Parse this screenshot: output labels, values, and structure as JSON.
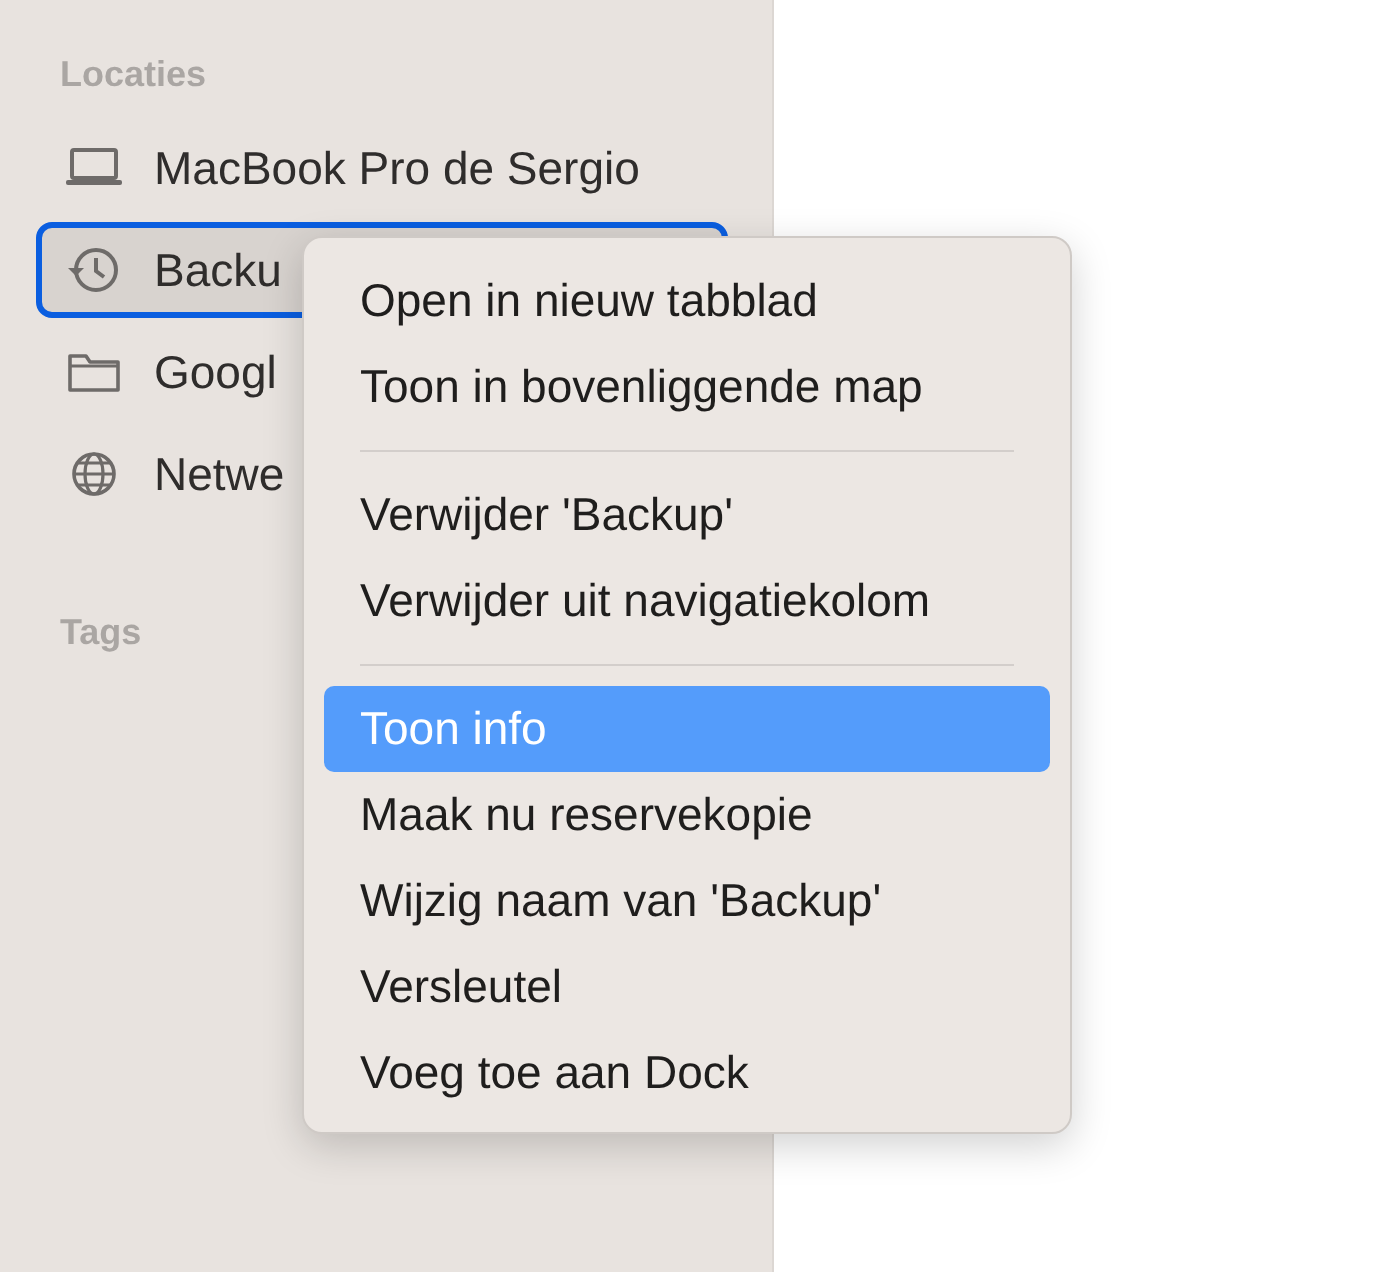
{
  "sidebar": {
    "sections": [
      {
        "title": "Locaties",
        "items": [
          {
            "label": "MacBook Pro de Sergio",
            "kind": "laptop",
            "selected": false
          },
          {
            "label": "Backu",
            "kind": "clock",
            "selected": true
          },
          {
            "label": "Googl",
            "kind": "folder",
            "selected": false
          },
          {
            "label": "Netwe",
            "kind": "globe",
            "selected": false
          }
        ]
      },
      {
        "title": "Tags"
      }
    ]
  },
  "context_menu": {
    "items": [
      {
        "kind": "item",
        "label": "Open in nieuw tabblad",
        "selected": false
      },
      {
        "kind": "item",
        "label": "Toon in bovenliggende map",
        "selected": false
      },
      {
        "kind": "separator"
      },
      {
        "kind": "item",
        "label": "Verwijder 'Backup'",
        "selected": false
      },
      {
        "kind": "item",
        "label": "Verwijder uit navigatiekolom",
        "selected": false
      },
      {
        "kind": "separator"
      },
      {
        "kind": "item",
        "label": "Toon info",
        "selected": true
      },
      {
        "kind": "item",
        "label": "Maak nu reservekopie",
        "selected": false
      },
      {
        "kind": "item",
        "label": "Wijzig naam van 'Backup'",
        "selected": false
      },
      {
        "kind": "item",
        "label": "Versleutel",
        "selected": false
      },
      {
        "kind": "item",
        "label": "Voeg toe aan Dock",
        "selected": false
      }
    ]
  }
}
